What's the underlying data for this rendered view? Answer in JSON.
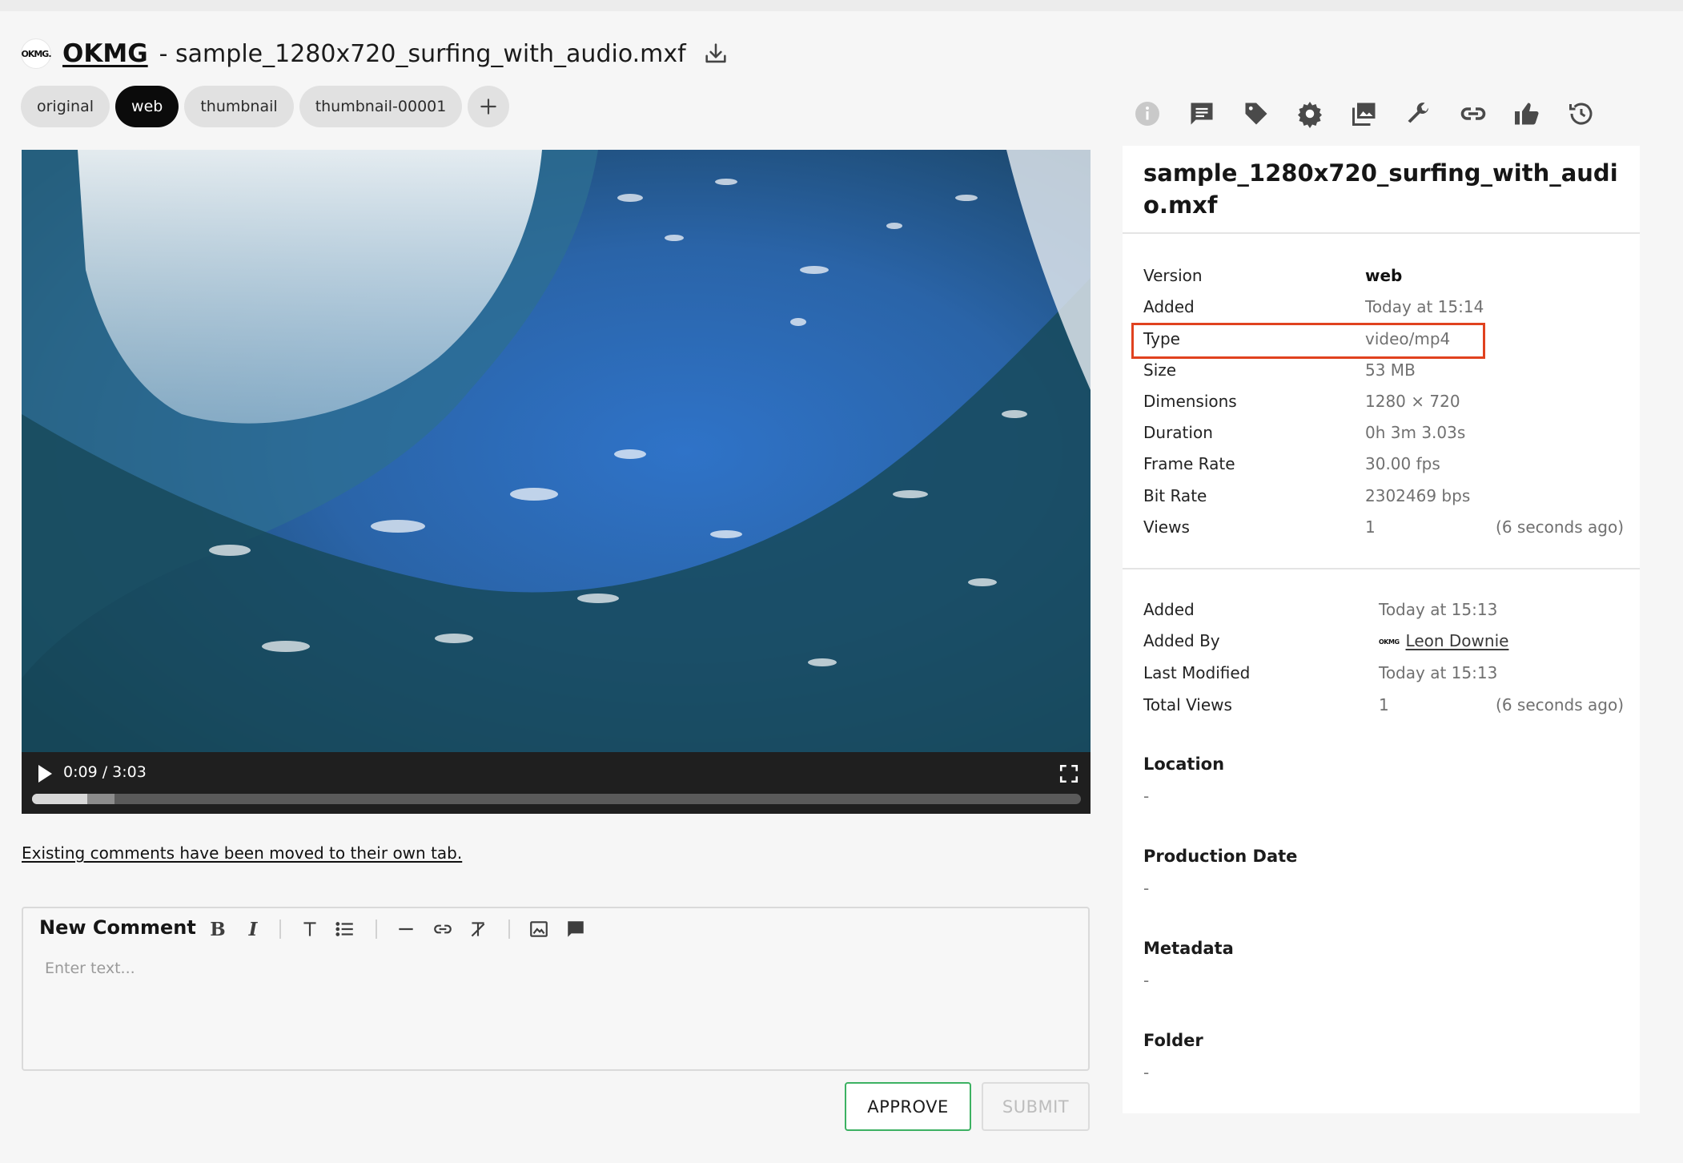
{
  "header": {
    "logo_text": "OKMG.",
    "brand": "OKMG",
    "filename": " - sample_1280x720_surfing_with_audio.mxf",
    "download_icon": "download-icon"
  },
  "versions": {
    "items": [
      "original",
      "web",
      "thumbnail",
      "thumbnail-00001"
    ],
    "active": "web",
    "add_icon": "plus-icon"
  },
  "player": {
    "time": "0:09 / 3:03",
    "played_fraction": 0.053,
    "buffered_fraction": 0.079,
    "play_icon": "play-icon",
    "fullscreen_icon": "fullscreen-icon"
  },
  "notice": "Existing comments have been moved to their own tab.",
  "comment": {
    "title": "New Comment",
    "placeholder": "Enter text...",
    "approve_label": "APPROVE",
    "submit_label": "SUBMIT",
    "toolbar": [
      "bold-icon",
      "italic-icon",
      "text-size-icon",
      "list-icon",
      "horizontal-rule-icon",
      "link-icon",
      "clear-format-icon",
      "image-icon",
      "comment-icon"
    ]
  },
  "iconbar": [
    "info-icon",
    "comments-icon",
    "tag-icon",
    "settings-icon",
    "gallery-icon",
    "wrench-icon",
    "link-icon",
    "thumbs-up-icon",
    "history-icon"
  ],
  "info": {
    "title": "sample_1280x720_surfing_with_audio.mxf",
    "version_rows": [
      {
        "label": "Version",
        "value": "web"
      },
      {
        "label": "Added",
        "value": "Today at 15:14"
      },
      {
        "label": "Type",
        "value": "video/mp4"
      },
      {
        "label": "Size",
        "value": "53 MB"
      },
      {
        "label": "Dimensions",
        "value": "1280 × 720"
      },
      {
        "label": "Duration",
        "value": "0h 3m 3.03s"
      },
      {
        "label": "Frame Rate",
        "value": "30.00 fps"
      },
      {
        "label": "Bit Rate",
        "value": "2302469 bps"
      },
      {
        "label": "Views",
        "value": "1",
        "extra": "(6 seconds ago)"
      }
    ],
    "asset_rows": [
      {
        "label": "Added",
        "value": "Today at 15:13"
      },
      {
        "label": "Added By",
        "value": "Leon Downie",
        "logo": "OKMG"
      },
      {
        "label": "Last Modified",
        "value": "Today at 15:13"
      },
      {
        "label": "Total Views",
        "value": "1",
        "extra": "(6 seconds ago)"
      }
    ],
    "sections": [
      {
        "label": "Location",
        "value": "-"
      },
      {
        "label": "Production Date",
        "value": "-"
      },
      {
        "label": "Metadata",
        "value": "-"
      },
      {
        "label": "Folder",
        "value": "-"
      }
    ]
  },
  "colors": {
    "highlight": "#e0421f",
    "approve_border": "#3cb162",
    "active_pill": "#0b0b0b"
  }
}
